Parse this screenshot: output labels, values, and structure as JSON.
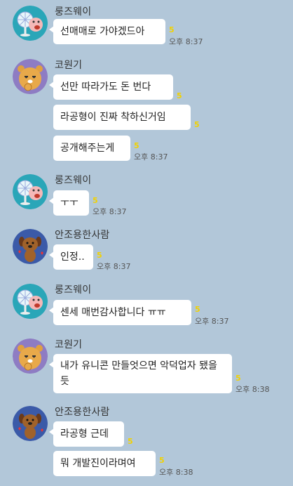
{
  "colors": {
    "background": "#b2c7d9",
    "bubble": "#ffffff",
    "unread": "#f2d200"
  },
  "avatars": {
    "fan": "fan-character-avatar",
    "ryan": "ryan-character-avatar",
    "frodo": "brown-dog-character-avatar"
  },
  "messages": [
    {
      "sender": "룽즈웨이",
      "avatar": "fan",
      "bubbles": [
        {
          "text": "선매매로 가야겠드아",
          "unread": "5",
          "time": "오후 8:37"
        }
      ]
    },
    {
      "sender": "코원기",
      "avatar": "ryan",
      "bubbles": [
        {
          "text": "선만 따라가도 돈 번다",
          "unread": "5",
          "time": ""
        },
        {
          "text": "라공형이 진짜 착하신거임",
          "unread": "5",
          "time": ""
        },
        {
          "text": "공개해주는게",
          "unread": "5",
          "time": "오후 8:37"
        }
      ]
    },
    {
      "sender": "룽즈웨이",
      "avatar": "fan",
      "bubbles": [
        {
          "text": "ㅜㅜ",
          "unread": "5",
          "time": "오후 8:37"
        }
      ]
    },
    {
      "sender": "안조용한사람",
      "avatar": "frodo",
      "bubbles": [
        {
          "text": "인정..",
          "unread": "5",
          "time": "오후 8:37"
        }
      ]
    },
    {
      "sender": "룽즈웨이",
      "avatar": "fan",
      "bubbles": [
        {
          "text": "센세 매번감사합니다 ㅠㅠ",
          "unread": "5",
          "time": "오후 8:37"
        }
      ]
    },
    {
      "sender": "코원기",
      "avatar": "ryan",
      "bubbles": [
        {
          "text": "내가 유니콘 만들엇으면 악덕업자 됐을듯",
          "unread": "5",
          "time": "오후 8:38"
        }
      ]
    },
    {
      "sender": "안조용한사람",
      "avatar": "frodo",
      "bubbles": [
        {
          "text": "라공형 근데",
          "unread": "5",
          "time": ""
        },
        {
          "text": "뭐 개발진이라며여",
          "unread": "5",
          "time": "오후 8:38"
        }
      ]
    }
  ]
}
